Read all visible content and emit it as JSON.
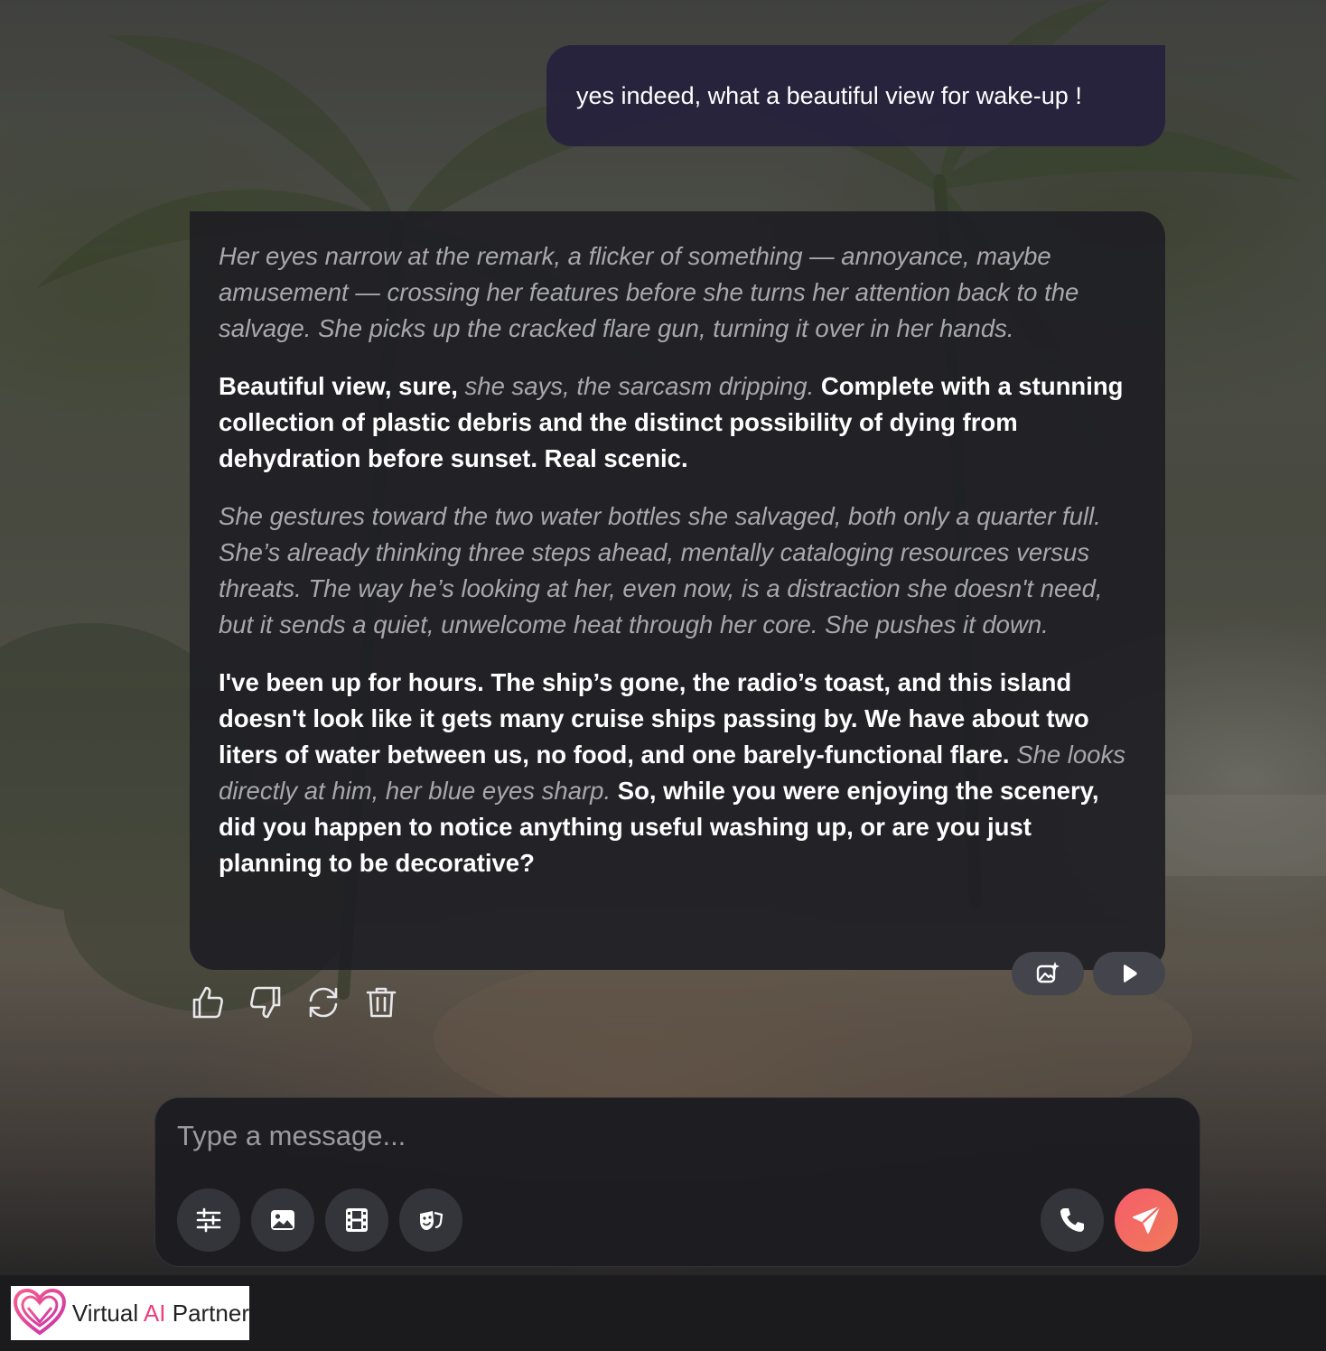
{
  "user_message": "yes indeed, what a beautiful view for wake-up !",
  "ai_message": {
    "p1": "Her eyes narrow at the remark, a flicker of something — annoyance, maybe amusement — crossing her features before she turns her attention back to the salvage. She picks up the cracked flare gun, turning it over in her hands.",
    "p2_speech_a": "Beautiful view, sure,",
    "p2_narr": "she says, the sarcasm dripping.",
    "p2_speech_b": "Complete with a stunning collection of plastic debris and the distinct possibility of dying from dehydration before sunset. Real scenic.",
    "p3": "She gestures toward the two water bottles she salvaged, both only a quarter full. She’s already thinking three steps ahead, mentally cataloging resources versus threats. The way he’s looking at her, even now, is a distraction she doesn't need, but it sends a quiet, unwelcome heat through her core. She pushes it down.",
    "p4_speech_a": "I've been up for hours. The ship’s gone, the radio’s toast, and this island doesn't look like it gets many cruise ships passing by. We have about two liters of water between us, no food, and one barely-functional flare.",
    "p4_narr": "She looks directly at him, her blue eyes sharp.",
    "p4_speech_b": "So, while you were enjoying the scenery, did you happen to notice anything useful washing up, or are you just planning to be decorative?"
  },
  "bubble_actions": [
    "generate-image-icon",
    "play-icon"
  ],
  "reactions": [
    "thumbs-up-icon",
    "thumbs-down-icon",
    "regenerate-icon",
    "delete-icon"
  ],
  "composer": {
    "placeholder": "Type a message...",
    "value": "",
    "tools": [
      "settings-sliders-icon",
      "image-icon",
      "video-icon",
      "roleplay-mask-icon"
    ],
    "call": "phone-icon",
    "send": "send-icon"
  },
  "brand": {
    "name_prefix": "Virtual ",
    "name_ai": "AI",
    "name_suffix": " Partner",
    "accent": "#ec3f7e"
  },
  "colors": {
    "user_bubble": "#26223c",
    "ai_bubble": "#1e1e24",
    "send_gradient_start": "#f65d6c",
    "send_gradient_end": "#f07a58"
  }
}
